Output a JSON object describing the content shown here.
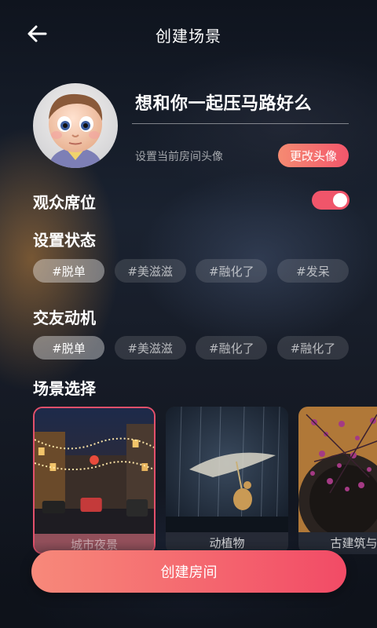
{
  "header": {
    "title": "创建场景",
    "back_icon": "arrow-left-icon"
  },
  "room": {
    "name": "想和你一起压马路好么",
    "avatar_hint": "设置当前房间头像",
    "change_avatar_label": "更改头像"
  },
  "audience": {
    "label": "观众席位",
    "enabled": true
  },
  "status": {
    "title": "设置状态",
    "tags": [
      {
        "label": "#脱单",
        "selected": true
      },
      {
        "label": "#美滋滋",
        "selected": false
      },
      {
        "label": "#融化了",
        "selected": false
      },
      {
        "label": "#发呆",
        "selected": false
      }
    ]
  },
  "motive": {
    "title": "交友动机",
    "tags": [
      {
        "label": "#脱单",
        "selected": true
      },
      {
        "label": "#美滋滋",
        "selected": false
      },
      {
        "label": "#融化了",
        "selected": false
      },
      {
        "label": "#融化了",
        "selected": false
      }
    ]
  },
  "scenes": {
    "title": "场景选择",
    "items": [
      {
        "label": "城市夜景",
        "selected": true
      },
      {
        "label": "动植物",
        "selected": false
      },
      {
        "label": "古建筑与风",
        "selected": false
      }
    ]
  },
  "footer": {
    "create_label": "创建房间"
  },
  "colors": {
    "accent_start": "#f7897a",
    "accent_end": "#f24b66",
    "toggle_on": "#f0556a"
  }
}
